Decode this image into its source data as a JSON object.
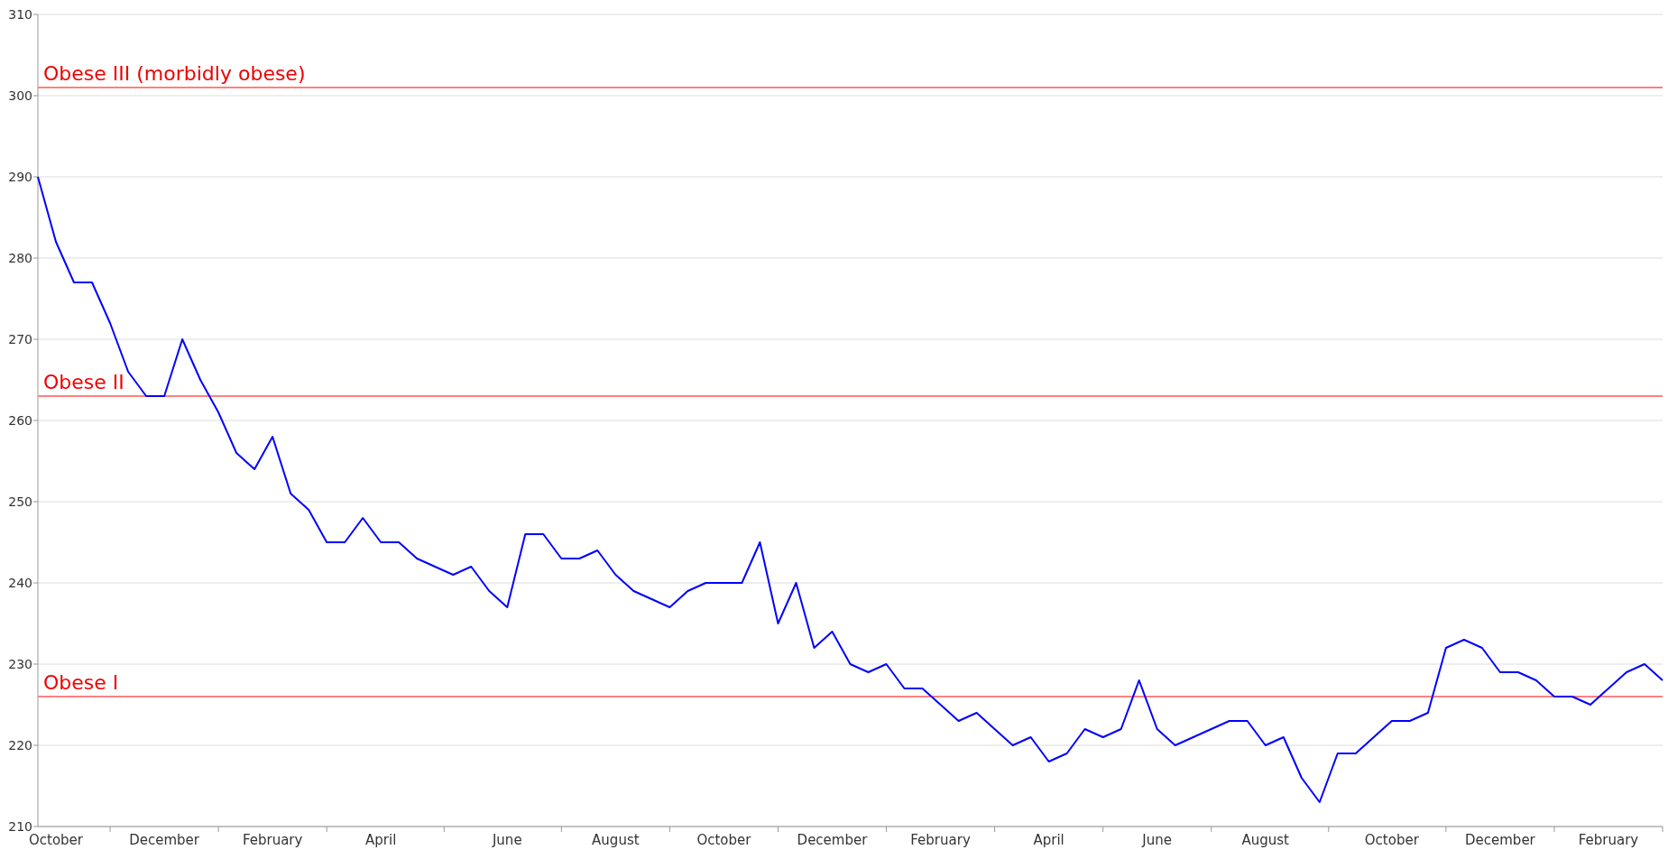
{
  "chart_data": {
    "type": "line",
    "categories": [
      null,
      "October",
      null,
      null,
      null,
      null,
      null,
      "December",
      null,
      null,
      null,
      null,
      null,
      "February",
      null,
      null,
      null,
      null,
      null,
      "April",
      null,
      null,
      null,
      null,
      null,
      null,
      "June",
      null,
      null,
      null,
      null,
      null,
      "August",
      null,
      null,
      null,
      null,
      null,
      "October",
      null,
      null,
      null,
      null,
      null,
      "December",
      null,
      null,
      null,
      null,
      null,
      "February",
      null,
      null,
      null,
      null,
      null,
      "April",
      null,
      null,
      null,
      null,
      null,
      "June",
      null,
      null,
      null,
      null,
      null,
      "August",
      null,
      null,
      null,
      null,
      null,
      null,
      "October",
      null,
      null,
      null,
      null,
      null,
      "December",
      null,
      null,
      null,
      null,
      null,
      "February",
      null,
      null,
      null
    ],
    "series": [
      {
        "color": "#0000ff",
        "values": [
          290,
          282,
          277,
          277,
          272,
          266,
          263,
          263,
          270,
          265,
          261,
          256,
          254,
          258,
          251,
          249,
          245,
          245,
          248,
          245,
          245,
          243,
          242,
          241,
          242,
          239,
          237,
          246,
          246,
          243,
          243,
          244,
          241,
          239,
          238,
          237,
          239,
          240,
          240,
          240,
          245,
          235,
          240,
          232,
          234,
          230,
          229,
          230,
          227,
          227,
          225,
          223,
          224,
          222,
          220,
          221,
          218,
          219,
          222,
          221,
          222,
          228,
          222,
          220,
          221,
          222,
          223,
          223,
          220,
          221,
          216,
          213,
          219,
          219,
          221,
          223,
          223,
          224,
          232,
          233,
          232,
          229,
          229,
          228,
          226,
          226,
          225,
          227,
          229,
          230,
          228
        ]
      }
    ],
    "ylim": [
      210,
      310
    ],
    "yticks": [
      210,
      220,
      230,
      240,
      250,
      260,
      270,
      280,
      290,
      300,
      310
    ],
    "grid": true,
    "ref_lines": [
      {
        "axis": "y",
        "value": 301,
        "label": "Obese III (morbidly obese)",
        "color": "#ff8080"
      },
      {
        "axis": "y",
        "value": 263,
        "label": "Obese II",
        "color": "#ff8080"
      },
      {
        "axis": "y",
        "value": 226,
        "label": "Obese I",
        "color": "#ff8080"
      }
    ]
  }
}
